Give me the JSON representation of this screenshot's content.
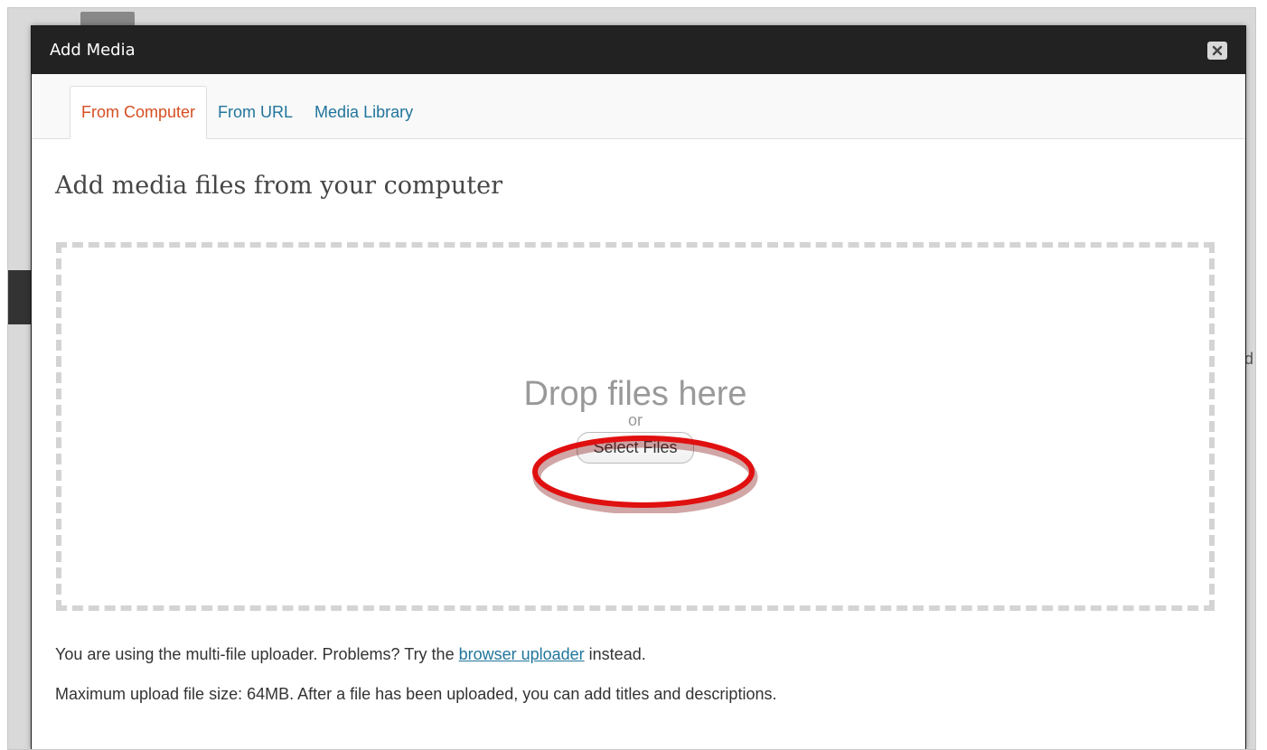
{
  "background": {
    "partial_text": "d"
  },
  "modal": {
    "title": "Add Media",
    "close_icon": "close-icon",
    "tabs": [
      {
        "label": "From Computer",
        "active": true
      },
      {
        "label": "From URL",
        "active": false
      },
      {
        "label": "Media Library",
        "active": false
      }
    ],
    "heading": "Add media files from your computer",
    "dropzone": {
      "drop_text": "Drop files here",
      "or_text": "or",
      "select_button": "Select Files"
    },
    "info": {
      "line1_prefix": "You are using the multi-file uploader. Problems? Try the ",
      "line1_link": "browser uploader",
      "line1_suffix": " instead.",
      "line2": "Maximum upload file size: 64MB. After a file has been uploaded, you can add titles and descriptions."
    }
  },
  "colors": {
    "titlebar": "#222222",
    "active_tab": "#d54e21",
    "link": "#21759b",
    "annotation_ring": "#e01010"
  }
}
